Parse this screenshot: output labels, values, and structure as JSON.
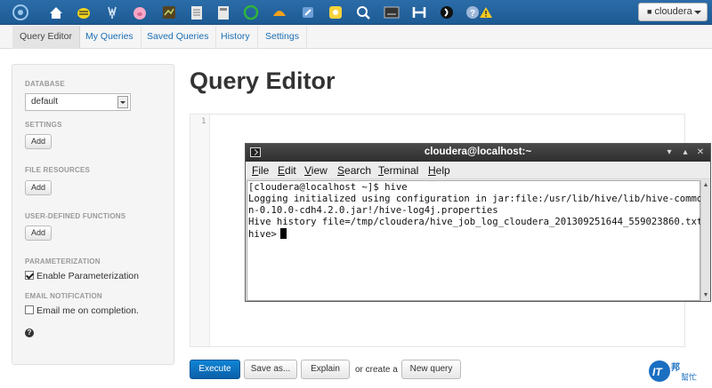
{
  "topbar": {
    "apps": [
      {
        "icon": "hue-logo-icon",
        "color": "#9bc7ec"
      },
      {
        "icon": "home-icon",
        "color": "#ffffff"
      },
      {
        "icon": "beeswax-hive-icon",
        "color": "#f2d21c"
      },
      {
        "icon": "impala-icon",
        "color": "#d8e7f6"
      },
      {
        "icon": "pig-icon",
        "color": "#f7a7c6"
      },
      {
        "icon": "job-designer-icon",
        "color": "#b9d46b"
      },
      {
        "icon": "file-browser-icon",
        "color": "#e8e8e8"
      },
      {
        "icon": "metastore-icon",
        "color": "#e8e8e8"
      },
      {
        "icon": "oozie-icon",
        "color": "#2fb43c"
      },
      {
        "icon": "hbase-icon",
        "color": "#f4a11c"
      },
      {
        "icon": "zookeeper-icon",
        "color": "#6f9fd8"
      },
      {
        "icon": "sqoop-icon",
        "color": "#f7d33b"
      },
      {
        "icon": "search-icon",
        "color": "#ffffff"
      },
      {
        "icon": "job-browser-icon",
        "color": "#333333"
      },
      {
        "icon": "hdfs-icon",
        "color": "#ffffff"
      },
      {
        "icon": "sqoop-dark-icon",
        "color": "#111111"
      },
      {
        "icon": "help-icon",
        "color": "#9cb7d9"
      },
      {
        "icon": "warning-icon",
        "color": "#f3c824"
      }
    ],
    "user_label": "cloudera"
  },
  "subnav": {
    "items": [
      "Query Editor",
      "My Queries",
      "Saved Queries",
      "History",
      "Settings"
    ],
    "active": "Query Editor"
  },
  "sidebar": {
    "database_label": "DATABASE",
    "database_value": "default",
    "settings_label": "SETTINGS",
    "file_resources_label": "FILE RESOURCES",
    "udf_label": "USER-DEFINED FUNCTIONS",
    "add_label": "Add",
    "parameterization_label": "PARAMETERIZATION",
    "enable_param_label": "Enable Parameterization",
    "enable_param_checked": true,
    "email_label": "EMAIL NOTIFICATION",
    "email_option_label": "Email me on completion.",
    "email_checked": false,
    "help_glyph": "?"
  },
  "main": {
    "title": "Query Editor",
    "line_number": "1",
    "execute_label": "Execute",
    "save_as_label": "Save as...",
    "explain_label": "Explain",
    "or_create_label": "or create a",
    "new_query_label": "New query"
  },
  "terminal": {
    "title": "cloudera@localhost:~",
    "menus": [
      {
        "underlined": "F",
        "rest": "ile"
      },
      {
        "underlined": "E",
        "rest": "dit"
      },
      {
        "underlined": "V",
        "rest": "iew"
      },
      {
        "underlined": "S",
        "rest": "earch"
      },
      {
        "underlined": "T",
        "rest": "erminal"
      },
      {
        "underlined": "H",
        "rest": "elp"
      }
    ],
    "lines": [
      "[cloudera@localhost ~]$ hive",
      "Logging initialized using configuration in jar:file:/usr/lib/hive/lib/hive-commo",
      "n-0.10.0-cdh4.2.0.jar!/hive-log4j.properties",
      "Hive history file=/tmp/cloudera/hive_job_log_cloudera_201309251644_559023860.txt",
      "hive>"
    ]
  },
  "watermark": {
    "text": "IT邦",
    "subtext": "幫忙"
  }
}
